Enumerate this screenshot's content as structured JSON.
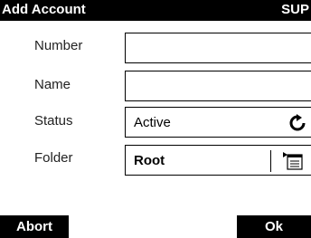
{
  "header": {
    "title": "Add Account",
    "user": "SUP"
  },
  "form": {
    "number": {
      "label": "Number",
      "value": ""
    },
    "name": {
      "label": "Name",
      "value": ""
    },
    "status": {
      "label": "Status",
      "value": "Active",
      "icon": "cycle-icon"
    },
    "folder": {
      "label": "Folder",
      "value": "Root",
      "icon": "folder-list-icon"
    }
  },
  "softkeys": {
    "left": "Abort",
    "right": "Ok"
  }
}
